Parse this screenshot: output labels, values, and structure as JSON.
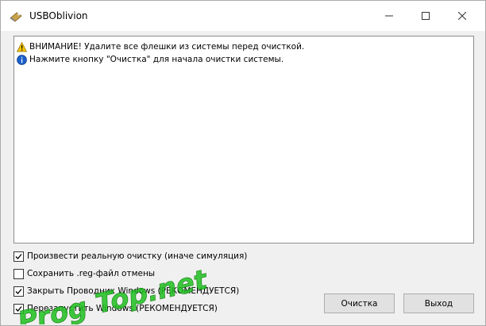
{
  "window": {
    "title": "USBOblivion"
  },
  "icons": {
    "app": "usb-drive-icon",
    "minimize": "minimize-icon",
    "maximize": "maximize-icon",
    "close": "close-icon",
    "warning": "warning-icon",
    "info": "info-icon",
    "checkbox_check": "checkmark-icon"
  },
  "log": {
    "lines": [
      {
        "type": "warning",
        "text": "ВНИМАНИЕ! Удалите все флешки из системы перед очисткой."
      },
      {
        "type": "info",
        "text": "Нажмите кнопку \"Очистка\" для начала очистки системы."
      }
    ]
  },
  "options": [
    {
      "label": "Произвести реальную очистку (иначе симуляция)",
      "checked": true
    },
    {
      "label": "Сохранить .reg-файл отмены",
      "checked": false
    },
    {
      "label": "Закрыть Проводник Windows (РЕКОМЕНДУЕТСЯ)",
      "checked": true
    },
    {
      "label": "Перезапустить Windows (РЕКОМЕНДУЕТСЯ)",
      "checked": true
    }
  ],
  "buttons": {
    "clean": "Очистка",
    "exit": "Выход"
  },
  "watermark": {
    "text": "Prog Top.net"
  },
  "colors": {
    "watermark_green": "#1fbf1f",
    "warning_yellow": "#f5c400",
    "info_blue": "#1c5fc9"
  }
}
